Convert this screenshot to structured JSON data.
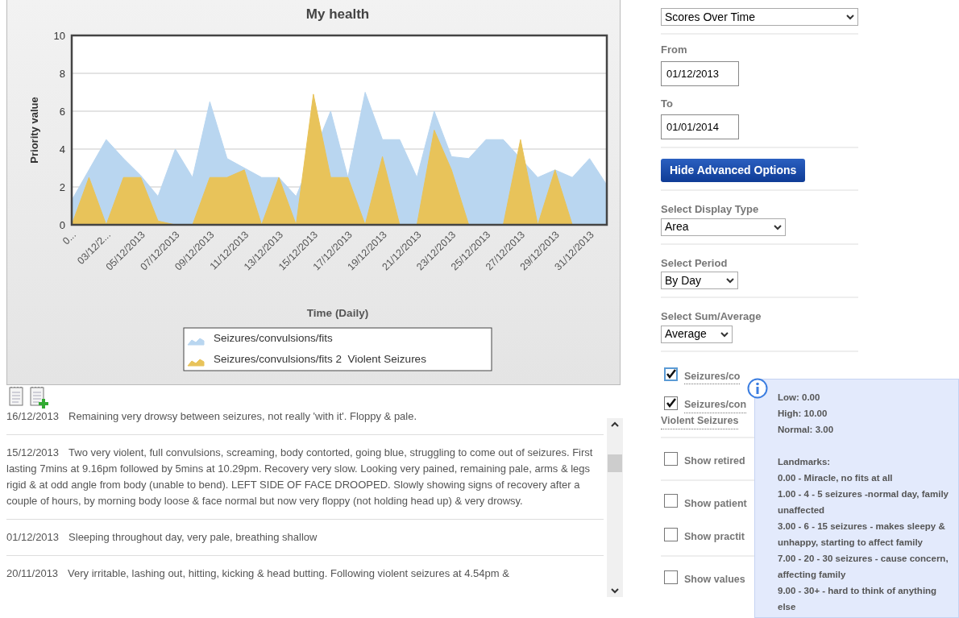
{
  "chart": {
    "chart_data": {
      "type": "area",
      "title": "My health",
      "xlabel": "Time (Daily)",
      "ylabel": "Priority value",
      "categories": [
        "0...",
        null,
        "03/12/2...",
        null,
        "05/12/2013",
        null,
        "07/12/2013",
        null,
        "09/12/2013",
        null,
        "11/12/2013",
        null,
        "13/12/2013",
        null,
        "15/12/2013",
        null,
        "17/12/2013",
        null,
        "19/12/2013",
        null,
        "21/12/2013",
        null,
        "23/12/2013",
        null,
        "25/12/2013",
        null,
        "27/12/2013",
        null,
        "29/12/2013",
        null,
        "31/12/2013",
        null
      ],
      "grid": true,
      "legend": true,
      "ylim": [
        0,
        10
      ],
      "yticks": [
        0,
        2,
        4,
        6,
        8,
        10
      ],
      "series": [
        {
          "name": "Seizures/convulsions/fits",
          "color": "#b9d6f0",
          "values": [
            1.3,
            2.9,
            4.5,
            3.5,
            2.6,
            1.5,
            4.0,
            2.5,
            6.5,
            3.5,
            null,
            2.5,
            2.5,
            1.5,
            null,
            6.0,
            2.5,
            7.0,
            4.5,
            4.5,
            2.5,
            6.0,
            3.6,
            3.5,
            4.5,
            4.5,
            null,
            2.5,
            2.9,
            2.5,
            3.5,
            2.1
          ]
        },
        {
          "name": "Seizures/convulsions/fits 2  Violent Seizures",
          "color": "#e8c35a",
          "values": [
            0,
            2.5,
            0,
            2.5,
            2.5,
            0.2,
            0,
            0,
            2.5,
            2.5,
            2.9,
            0,
            2.5,
            0,
            6.9,
            2.5,
            2.5,
            0,
            3.6,
            0,
            0,
            5.0,
            2.9,
            0,
            0,
            0,
            4.5,
            0,
            2.9,
            0,
            0,
            0
          ]
        }
      ]
    }
  },
  "notes": [
    {
      "date": "16/12/2013",
      "text": "Remaining very drowsy between seizures, not really 'with it'. Floppy & pale."
    },
    {
      "date": "15/12/2013",
      "text": "Two very violent, full convulsions, screaming, body contorted, going blue, struggling to come out of seizures. First lasting 7mins at 9.16pm followed by 5mins at 10.29pm. Recovery very slow. Looking very pained, remaining pale, arms & legs rigid & at odd angle from body (unable to bend). LEFT SIDE OF FACE DROOPED. Slowly showing signs of recovery after a couple of hours, by morning body loose & face normal but now very floppy (not holding head up) & very drowsy."
    },
    {
      "date": "01/12/2013",
      "text": "Sleeping throughout day, very pale, breathing shallow"
    },
    {
      "date": "20/11/2013",
      "text": "Very irritable, lashing out, hitting, kicking & head butting. Following violent seizures at 4.54pm &"
    }
  ],
  "options": {
    "report_select": "Scores Over Time",
    "from_label": "From",
    "from_value": "01/12/2013",
    "to_label": "To",
    "to_value": "01/01/2014",
    "advanced_button": "Hide Advanced Options",
    "display_type": {
      "label": "Select Display Type",
      "value": "Area"
    },
    "period": {
      "label": "Select Period",
      "value": "By Day"
    },
    "sum_average": {
      "label": "Select Sum/Average",
      "value": "Average"
    },
    "symptoms": [
      {
        "label": "Seizures/co",
        "checked": true
      },
      {
        "label": "Seizures/con",
        "sublabel": "Violent Seizures",
        "checked": true
      }
    ],
    "toggles": [
      {
        "label": "Show retired",
        "checked": false
      },
      {
        "label": "Show patient",
        "checked": false
      },
      {
        "label": "Show practit",
        "checked": false
      },
      {
        "label": "Show values",
        "checked": false
      }
    ]
  },
  "tooltip": {
    "summary": [
      "Low: 0.00",
      "High: 10.00",
      "Normal: 3.00"
    ],
    "landmarks_title": "Landmarks:",
    "landmarks": [
      "0.00 - Miracle, no fits at all",
      "1.00 - 4 - 5 seizures -normal day, family unaffected",
      "3.00 - 6 - 15 seizures - makes sleepy & unhappy, starting to affect family",
      "7.00 - 20 - 30 seizures - cause concern, affecting family",
      "9.00 - 30+ - hard to think of anything else"
    ]
  }
}
